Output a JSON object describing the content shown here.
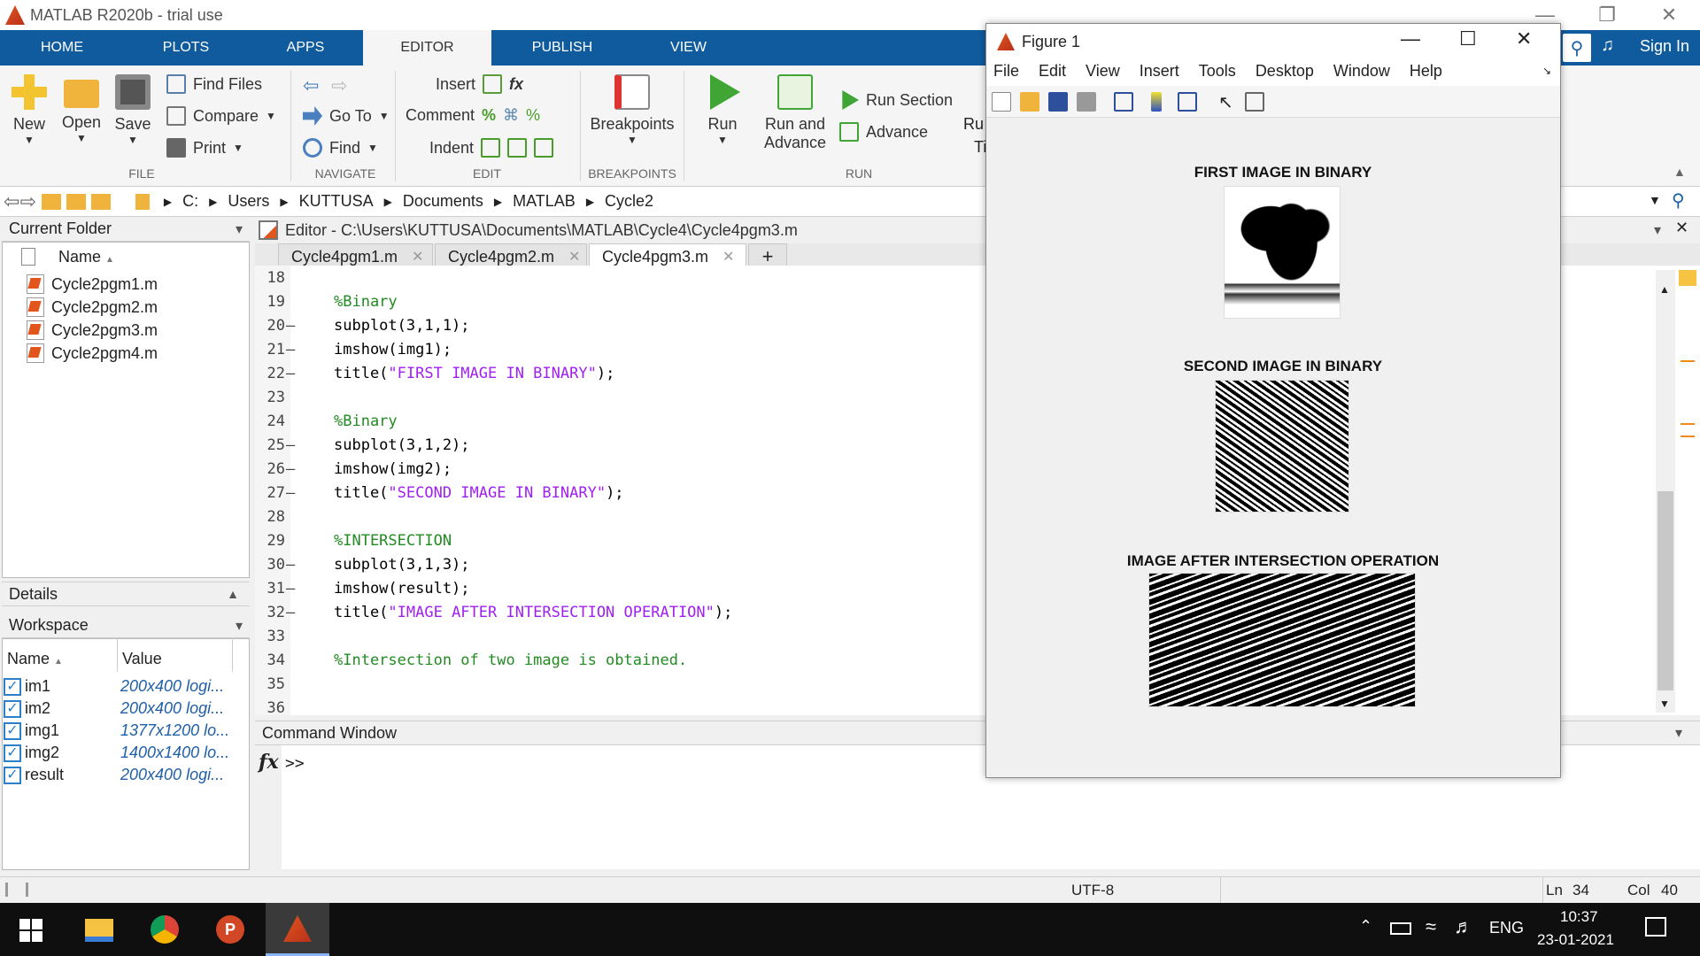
{
  "app": {
    "title": "MATLAB R2020b - trial use",
    "sign_in": "Sign In"
  },
  "ribbon_tabs": [
    "HOME",
    "PLOTS",
    "APPS",
    "EDITOR",
    "PUBLISH",
    "VIEW"
  ],
  "ribbon": {
    "file": {
      "new": "New",
      "open": "Open",
      "save": "Save",
      "find_files": "Find Files",
      "compare": "Compare",
      "print": "Print",
      "group": "FILE"
    },
    "navigate": {
      "go_to": "Go To",
      "find": "Find",
      "group": "NAVIGATE"
    },
    "edit": {
      "insert": "Insert",
      "comment": "Comment",
      "indent": "Indent",
      "group": "EDIT"
    },
    "breakpoints": {
      "label": "Breakpoints",
      "group": "BREAKPOINTS"
    },
    "run": {
      "run": "Run",
      "run_and": "Run and",
      "advance_word": "Advance",
      "run_section": "Run Section",
      "advance": "Advance",
      "run_trunc": "Ru",
      "ti_trunc": "Ti",
      "group": "RUN"
    }
  },
  "address": [
    "C:",
    "Users",
    "KUTTUSA",
    "Documents",
    "MATLAB",
    "Cycle2"
  ],
  "current_folder": {
    "title": "Current Folder",
    "column": "Name",
    "files": [
      "Cycle2pgm1.m",
      "Cycle2pgm2.m",
      "Cycle2pgm3.m",
      "Cycle2pgm4.m"
    ]
  },
  "details": {
    "title": "Details"
  },
  "workspace": {
    "title": "Workspace",
    "col_name": "Name",
    "col_value": "Value",
    "vars": [
      {
        "name": "im1",
        "value": "200x400 logi..."
      },
      {
        "name": "im2",
        "value": "200x400 logi..."
      },
      {
        "name": "img1",
        "value": "1377x1200 lo..."
      },
      {
        "name": "img2",
        "value": "1400x1400 lo..."
      },
      {
        "name": "result",
        "value": "200x400 logi..."
      }
    ]
  },
  "editor": {
    "path": "Editor - C:\\Users\\KUTTUSA\\Documents\\MATLAB\\Cycle4\\Cycle4pgm3.m",
    "tabs": [
      "Cycle4pgm1.m",
      "Cycle4pgm2.m",
      "Cycle4pgm3.m"
    ],
    "lines": [
      {
        "n": "18",
        "dash": "",
        "text": ""
      },
      {
        "n": "19",
        "dash": "",
        "text": "%Binary"
      },
      {
        "n": "20",
        "dash": "—",
        "text": "subplot(3,1,1);"
      },
      {
        "n": "21",
        "dash": "—",
        "text": "imshow(img1);"
      },
      {
        "n": "22",
        "dash": "—",
        "text": "title(\"FIRST IMAGE IN BINARY\");"
      },
      {
        "n": "23",
        "dash": "",
        "text": ""
      },
      {
        "n": "24",
        "dash": "",
        "text": "%Binary"
      },
      {
        "n": "25",
        "dash": "—",
        "text": "subplot(3,1,2);"
      },
      {
        "n": "26",
        "dash": "—",
        "text": "imshow(img2);"
      },
      {
        "n": "27",
        "dash": "—",
        "text": "title(\"SECOND IMAGE IN BINARY\");"
      },
      {
        "n": "28",
        "dash": "",
        "text": ""
      },
      {
        "n": "29",
        "dash": "",
        "text": "%INTERSECTION"
      },
      {
        "n": "30",
        "dash": "—",
        "text": "subplot(3,1,3);"
      },
      {
        "n": "31",
        "dash": "—",
        "text": "imshow(result);"
      },
      {
        "n": "32",
        "dash": "—",
        "text": "title(\"IMAGE AFTER INTERSECTION OPERATION\");"
      },
      {
        "n": "33",
        "dash": "",
        "text": ""
      },
      {
        "n": "34",
        "dash": "",
        "text": "%Intersection of two image is obtained."
      },
      {
        "n": "35",
        "dash": "",
        "text": ""
      },
      {
        "n": "36",
        "dash": "",
        "text": ""
      }
    ]
  },
  "command_window": {
    "title": "Command Window",
    "fx": "fx",
    "prompt": ">>"
  },
  "status": {
    "encoding": "UTF-8",
    "ln_label": "Ln",
    "ln": "34",
    "col_label": "Col",
    "col": "40"
  },
  "figure": {
    "title": "Figure 1",
    "menu": [
      "File",
      "Edit",
      "View",
      "Insert",
      "Tools",
      "Desktop",
      "Window",
      "Help"
    ],
    "subplots": [
      {
        "title": "FIRST IMAGE IN BINARY"
      },
      {
        "title": "SECOND IMAGE IN BINARY"
      },
      {
        "title": "IMAGE AFTER INTERSECTION OPERATION"
      }
    ]
  },
  "taskbar": {
    "lang": "ENG",
    "time": "10:37",
    "date": "23-01-2021"
  },
  "colors": {
    "ribbon_blue": "#0f5b9d",
    "comment_green": "#228b22",
    "string_purple": "#a020f0",
    "taskbar": "#0f0f0f"
  }
}
